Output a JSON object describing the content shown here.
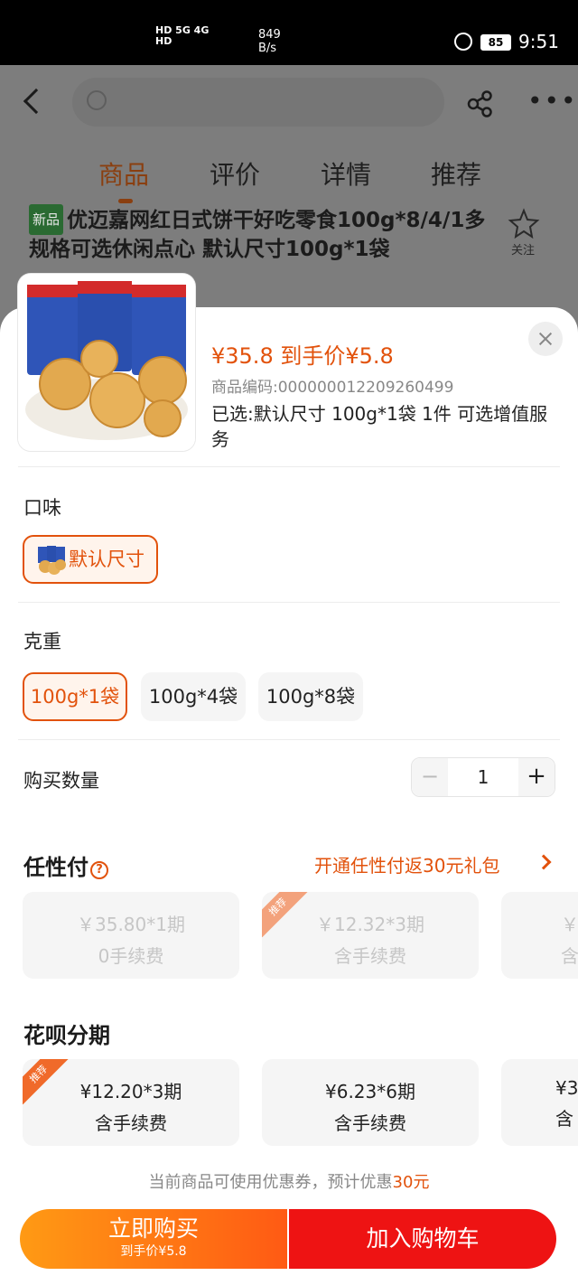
{
  "status_bar": {
    "sig_top": "HD 5G 4G",
    "sig_bottom": "HD",
    "speed_value": "849",
    "speed_unit": "B/s",
    "battery": "85",
    "time": "9:51"
  },
  "background": {
    "tabs": [
      "商品",
      "评价",
      "详情",
      "推荐"
    ],
    "new_badge": "新品",
    "product_title": "优迈嘉网红日式饼干好吃零食100g*8/4/1多规格可选休闲点心 默认尺寸100g*1袋",
    "fav_label": "关注"
  },
  "sheet": {
    "price_line": "¥35.8 到手价¥5.8",
    "sku_code": "商品编码:000000012209260499",
    "selected_info": "已选:默认尺寸  100g*1袋  1件  可选增值服务",
    "flavor_label": "口味",
    "flavor_options": [
      "默认尺寸"
    ],
    "weight_label": "克重",
    "weight_options": [
      "100g*1袋",
      "100g*4袋",
      "100g*8袋"
    ],
    "quantity_label": "购买数量",
    "quantity_value": "1",
    "minus_symbol": "−",
    "plus_symbol": "+",
    "renxingfu_title": "任性付",
    "help_symbol": "?",
    "renxingfu_promo": "开通任性付返30元礼包",
    "renxingfu_cards": [
      {
        "line1": "￥35.80*1期",
        "line2": "0手续费"
      },
      {
        "line1": "￥12.32*3期",
        "line2": "含手续费",
        "badge": "推荐"
      },
      {
        "line1": "￥",
        "line2": "含"
      }
    ],
    "huabei_title": "花呗分期",
    "huabei_cards": [
      {
        "line1": "¥12.20*3期",
        "line2": "含手续费",
        "badge": "推荐"
      },
      {
        "line1": "¥6.23*6期",
        "line2": "含手续费"
      },
      {
        "line1": "¥3",
        "line2": "含"
      }
    ],
    "coupon_note_prefix": "当前商品可使用优惠券，预计优惠",
    "coupon_note_amount": "30元",
    "buy_now": "立即购买",
    "buy_now_sub": "到手价¥5.8",
    "add_cart": "加入购物车"
  },
  "colors": {
    "accent": "#e2520c",
    "cart_red": "#ee1313",
    "buy_orange": "#ff7a14"
  }
}
